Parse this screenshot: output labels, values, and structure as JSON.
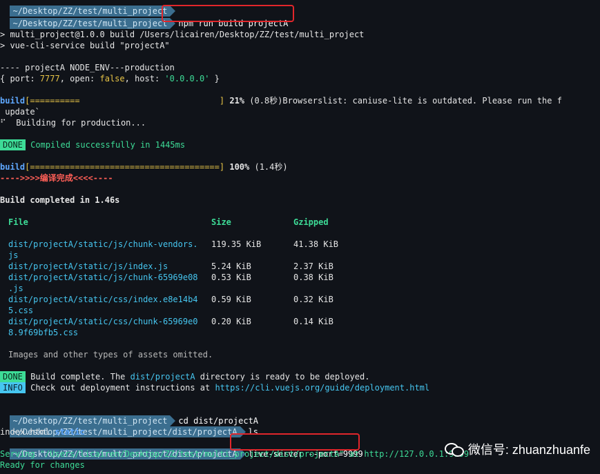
{
  "prompts": {
    "top_path_partial": "~/Desktop/ZZ/test/multi_project",
    "path_multi": "~/Desktop/ZZ/test/multi_project",
    "path_dist": "~/Desktop/ZZ/test/multi_project/dist/projectA"
  },
  "commands": {
    "build": "npm run build projectA",
    "cd": "cd dist/projectA",
    "ls": "ls",
    "live_server": "live-server --port=9999"
  },
  "output": {
    "npm_line1": "> multi_project@1.0.0 build /Users/licairen/Desktop/ZZ/test/multi_project",
    "npm_line2": "> vue-cli-service build \"projectA\"",
    "env_line": "---- projectA NODE_ENV---production",
    "config_open": "{ port: ",
    "config_port": "7777",
    "config_mid1": ", open: ",
    "config_open_val": "false",
    "config_mid2": ", host: ",
    "config_host": "'0.0.0.0'",
    "config_close": " }",
    "progress1_label": "build",
    "progress1_bar": "[==========                            ]",
    "progress1_pct": "21%",
    "progress1_rest": " (0.8秒)Browserslist: caniuse-lite is outdated. Please run the f",
    "update_line": " update`",
    "building_line": "⠋  Building for production...",
    "done_badge": "DONE",
    "compiled_text": "Compiled successfully in 1445ms",
    "progress2_label": "build",
    "progress2_bar": "[======================================]",
    "progress2_pct": "100%",
    "progress2_rest": " (1.4秒)",
    "custom_done": "---->>>>编译完成<<<<----",
    "build_completed": "Build completed in 1.46s",
    "images_omitted": "Images and other types of assets omitted.",
    "done_badge2": "DONE",
    "build_complete_pre": "Build complete. The ",
    "build_complete_dir": "dist/projectA",
    "build_complete_post": " directory is ready to be deployed.",
    "info_badge": "INFO",
    "check_out_pre": "Check out deployment instructions at ",
    "check_out_url": "https://cli.vuejs.org/guide/deployment.html",
    "ls_file": "index.html ",
    "ls_dir": "static",
    "serving_line": "Serving \"/Users/licairen/Desktop/ZZ/test/multi_project/dist/projectA\" at http://127.0.0.1:9999",
    "ready_line": "Ready for changes"
  },
  "table": {
    "headers": [
      "File",
      "Size",
      "Gzipped"
    ],
    "rows": [
      {
        "file1": "dist/projectA/static/js/chunk-vendors.",
        "file2": "js",
        "size": "119.35 KiB",
        "gzip": "41.38 KiB"
      },
      {
        "file1": "dist/projectA/static/js/index.js",
        "file2": "",
        "size": "5.24 KiB",
        "gzip": "2.37 KiB"
      },
      {
        "file1": "dist/projectA/static/js/chunk-65969e08",
        "file2": ".js",
        "size": "0.53 KiB",
        "gzip": "0.38 KiB"
      },
      {
        "file1": "dist/projectA/static/css/index.e8e14b4",
        "file2": "5.css",
        "size": "0.59 KiB",
        "gzip": "0.32 KiB"
      },
      {
        "file1": "dist/projectA/static/css/chunk-65969e0",
        "file2": "8.9f69bfb5.css",
        "size": "0.20 KiB",
        "gzip": "0.14 KiB"
      }
    ]
  },
  "watermark": {
    "text": "微信号: zhuanzhuanfe",
    "icon": "wechat-icon"
  },
  "colors": {
    "background": "#101319",
    "prompt_bg": "#3b6e8f",
    "highlight_border": "#e2262b",
    "done_bg": "#3ddc97",
    "info_bg": "#46c6f0",
    "file_color": "#46c6f0",
    "size_color": "#e8c547"
  }
}
